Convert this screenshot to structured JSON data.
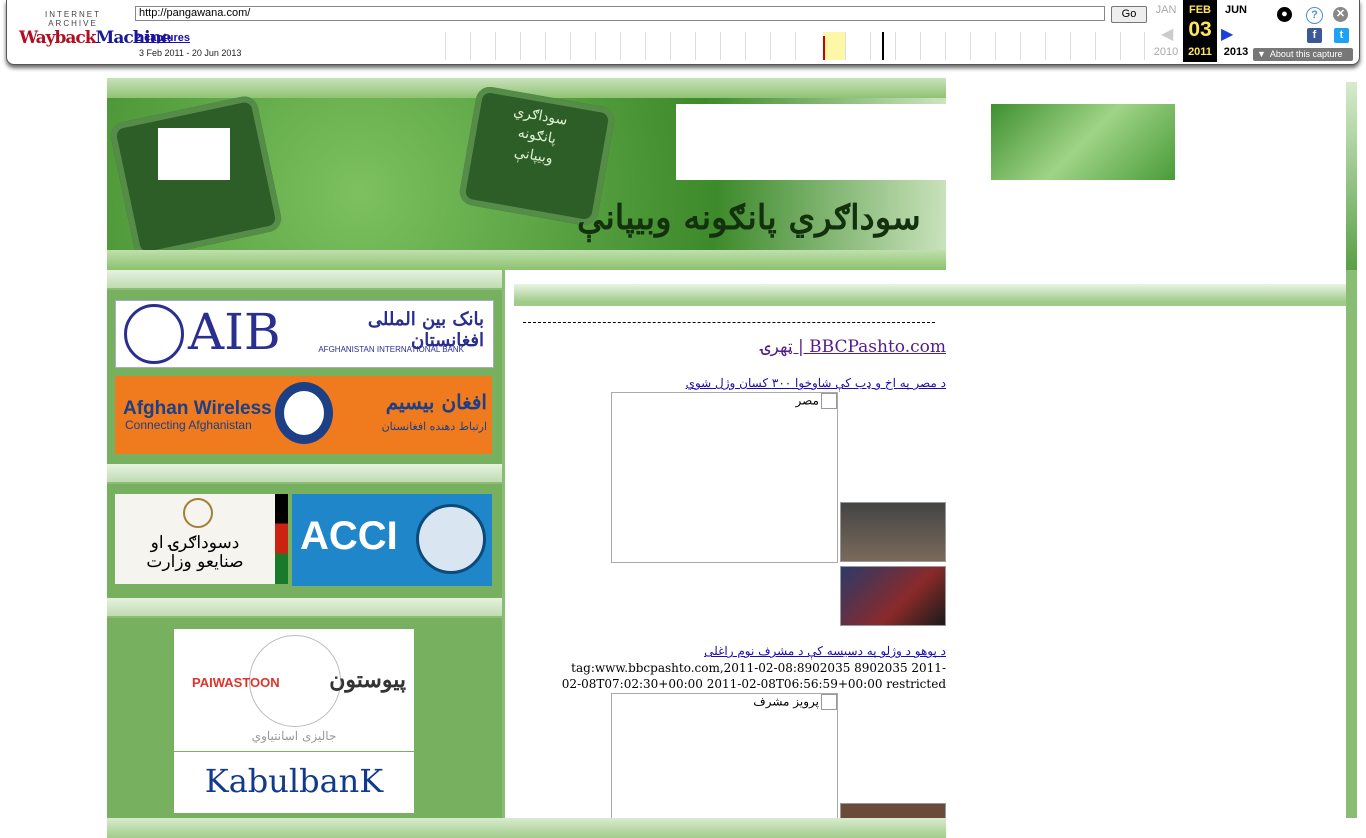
{
  "wayback": {
    "logo_top": "INTERNET ARCHIVE",
    "logo_main_a": "Wayback",
    "logo_main_b": "Machine",
    "url": "http://pangawana.com/",
    "go_label": "Go",
    "captures": "2 captures",
    "range": "3 Feb 2011 - 20 Jun 2013",
    "prev_month": "JAN",
    "cur_month": "FEB",
    "next_month": "JUN",
    "cur_day": "03",
    "prev_year": "2010",
    "cur_year": "2011",
    "next_year": "2013",
    "about": "About this capture",
    "help_icon": "?",
    "close_icon": "✕",
    "fb_icon": "f",
    "tw_icon": "t",
    "user_icon": "●",
    "prev_arrow": "◀",
    "next_arrow": "▶",
    "about_arrow": "▼"
  },
  "banner": {
    "slogan": "سوداګري پانګونه وبیپانې",
    "device_text": "سوداګري\nپانګونه\nوبیپانې"
  },
  "logos": {
    "aib_name": "AIB",
    "aib_ar": "بانک بین المللی افغانستان",
    "aib_en": "AFGHANISTAN INTERNATIONAL BANK",
    "aw_name": "Afghan Wireless",
    "aw_sub": "Connecting Afghanistan",
    "aw_ar": "افغان بیسیم",
    "aw_ar_sub": "ارتباط دهنده افغانستان",
    "moc_l1": "دسوداګرۍ او",
    "moc_l2": "صنایعو وزارت",
    "acci": "ACCI",
    "pw_name": "PAIWASTOON",
    "pw_ar": "پیوستون",
    "pw_sub": "جالیزی اسانتیاوي",
    "kb": "KabulbanK"
  },
  "feed": {
    "title": "BBCPashto.com | ټهرۍ",
    "items": [
      {
        "headline": "د مصر په اخ و ډب کې شاوخوا ۳۰۰ کسان وژل شوي",
        "img_alt": "مصر"
      },
      {
        "headline": "د پوهو د وژلو په دسیسه کې د مشرف نوم راغلی",
        "meta": "tag:www.bbcpashto.com,2011-02-08:8902035 8902035 2011-02-08T07:02:30+00:00 2011-02-08T06:56:59+00:00 restricted",
        "img_alt": "پرویز مشرف"
      }
    ]
  },
  "colors": {
    "green_dark": "#3d8a2b",
    "green_col": "#77b05f",
    "link": "#1a0dab",
    "visited": "#551a8b"
  }
}
